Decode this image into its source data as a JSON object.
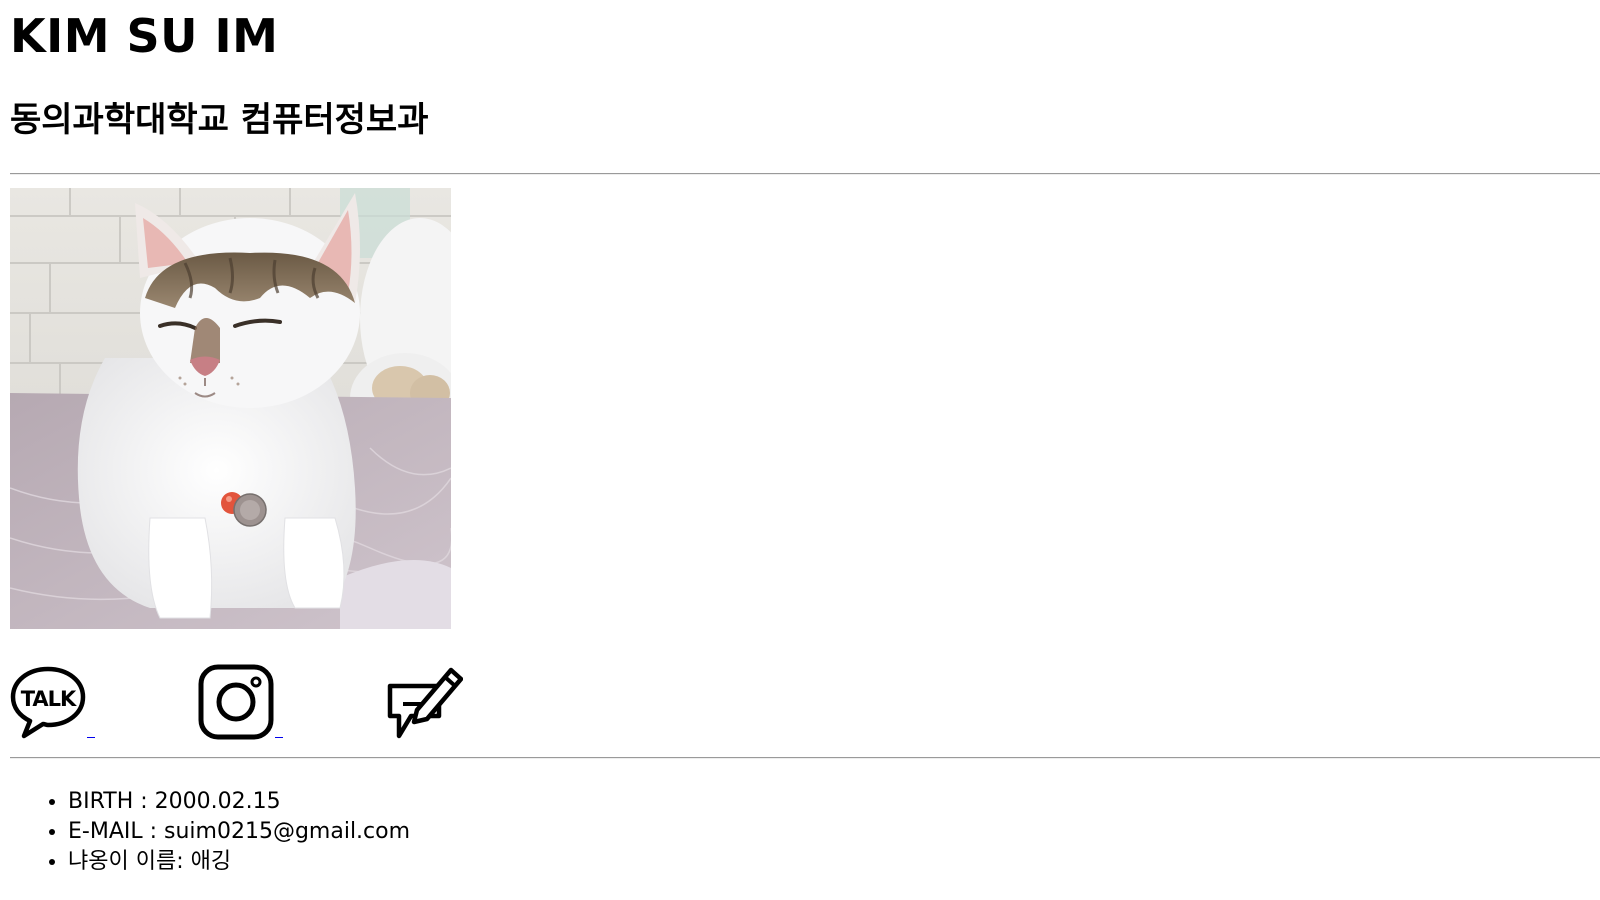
{
  "header": {
    "name": "KIM SU IM",
    "school": "동의과학대학교 컴퓨터정보과"
  },
  "photo": {
    "subject": "cat photo"
  },
  "social": {
    "kakao_icon": "kakaotalk-icon",
    "instagram_icon": "instagram-icon",
    "blog_icon": "blog-edit-icon"
  },
  "info": {
    "items": [
      "BIRTH : 2000.02.15",
      "E-MAIL : suim0215@gmail.com",
      "냐옹이 이름: 애깅"
    ]
  },
  "colors": {
    "link_underline": "#0000ee",
    "divider": "#9a9a9a"
  }
}
